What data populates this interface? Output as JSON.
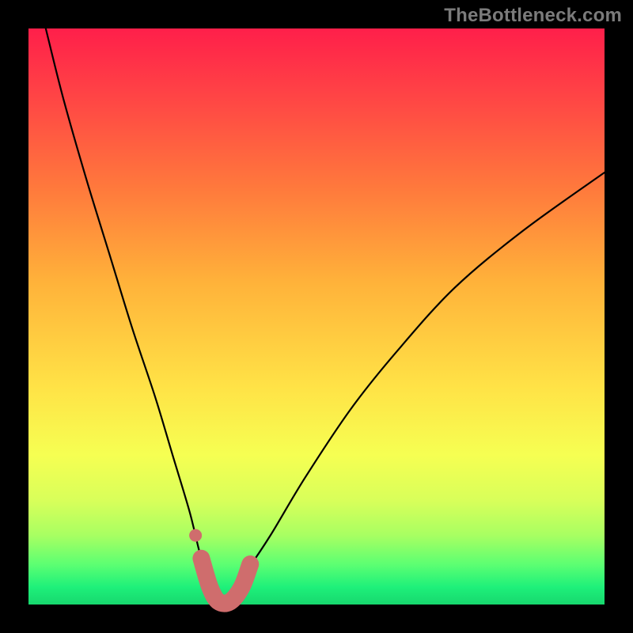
{
  "watermark": {
    "text": "TheBottleneck.com"
  },
  "colors": {
    "background": "#000000",
    "accent_pink": "#cf6d6d",
    "curve": "#000000",
    "gradient_top": "#ff1f4a",
    "gradient_bottom": "#17d86e"
  },
  "chart_data": {
    "type": "line",
    "title": "",
    "xlabel": "",
    "ylabel": "",
    "xlim": [
      0,
      100
    ],
    "ylim": [
      0,
      100
    ],
    "grid": false,
    "legend": false,
    "annotations": [
      "TheBottleneck.com"
    ],
    "background": "vertical red→yellow→green gradient",
    "series": [
      {
        "name": "bottleneck-curve",
        "note": "black V-shaped curve; minimum ≈ x 33, y 0; right arm shallower than left",
        "x": [
          3,
          6,
          10,
          14,
          18,
          22,
          25,
          28,
          30,
          32,
          33,
          35,
          38,
          42,
          48,
          56,
          64,
          74,
          86,
          100
        ],
        "y": [
          100,
          88,
          74,
          61,
          48,
          36,
          26,
          16,
          8,
          3,
          0,
          2,
          6,
          12,
          22,
          34,
          44,
          55,
          65,
          75
        ]
      },
      {
        "name": "highlight-trough",
        "note": "thick pink U segment sitting at the bottom of the curve",
        "x": [
          30,
          31.5,
          33,
          35,
          37,
          38.5
        ],
        "y": [
          8,
          3,
          0.5,
          0.5,
          3,
          7
        ]
      },
      {
        "name": "highlight-dot",
        "note": "single pink dot just above-left of the trough",
        "x": [
          29
        ],
        "y": [
          12
        ]
      }
    ]
  }
}
